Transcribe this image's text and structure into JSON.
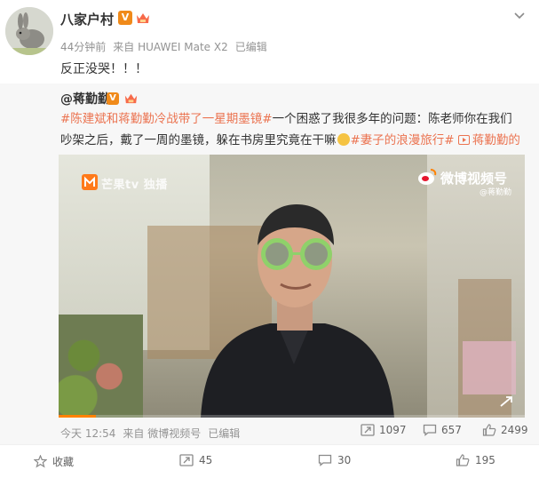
{
  "post": {
    "author": "八家户村",
    "verified_badge": "V",
    "meta": {
      "time": "44分钟前",
      "source": "来自 HUAWEI Mate X2",
      "edited": "已编辑"
    },
    "text": "反正没哭！！！"
  },
  "repost": {
    "author": "@蒋勤勤",
    "verified_badge": "V",
    "hashtag1": "#陈建斌和蒋勤勤冷战带了一星期墨镜#",
    "text1": "一个困惑了我很多年的问题：陈老师你在我们吵架之后，戴了一周的墨镜，躲在书房里究竟在干嘛",
    "hashtag2": "#妻子的浪漫旅行#",
    "video_link": "蒋勤勤的微博视频",
    "video": {
      "watermark_left": "芒果tv 独播",
      "watermark_right_title": "微博视频号",
      "watermark_right_sub": "@蒋勤勤",
      "progress": 0.08
    },
    "footer": {
      "time": "今天 12:54",
      "source": "来自 微博视频号",
      "edited": "已编辑",
      "reposts": "1097",
      "comments": "657",
      "likes": "2499"
    }
  },
  "actions": {
    "favorite": "收藏",
    "repost": "45",
    "comment": "30",
    "like": "195"
  },
  "colors": {
    "accent": "#eb7350",
    "brand_orange": "#ff8200",
    "badge": "#f08a1a"
  }
}
